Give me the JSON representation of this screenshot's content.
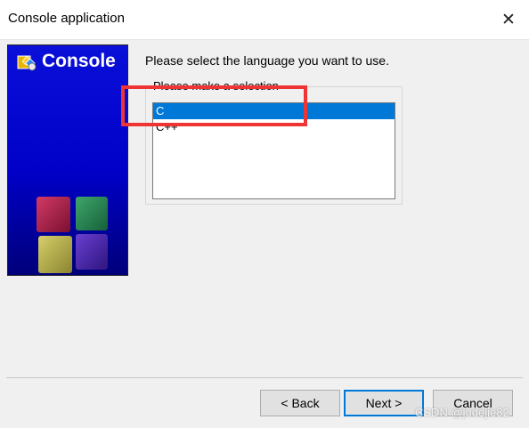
{
  "window": {
    "title": "Console application",
    "close_glyph": "✕"
  },
  "banner": {
    "title": "Console",
    "logo_icon": "codeblocks-logo-icon",
    "artwork_icon": "colored-cubes-icon",
    "colors": {
      "gradient_top": "#0a10d8",
      "gradient_bottom": "#00007a"
    }
  },
  "main": {
    "intro_text": "Please select the language you want to use.",
    "group_label": "Please make a selection",
    "languages": [
      "C",
      "C++"
    ],
    "selected": "C"
  },
  "buttons": {
    "back_label": "< Back",
    "next_label": "Next >",
    "cancel_label": "Cancel"
  },
  "watermark": "CSDN @judejie82",
  "colors": {
    "selection": "#0078d7",
    "highlight_box": "#ee3434",
    "default_button_border": "#0078d7"
  }
}
